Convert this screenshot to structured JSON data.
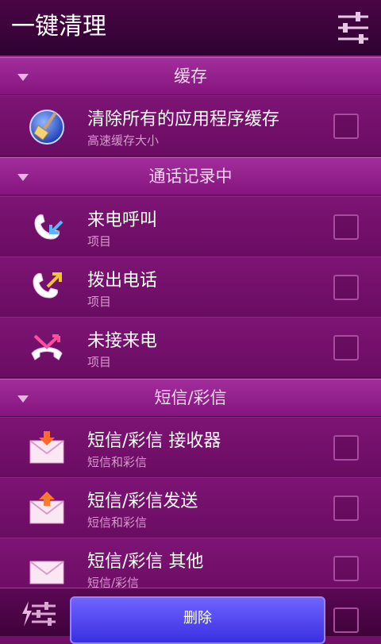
{
  "header": {
    "title": "一键清理",
    "settings_icon": "sliders-icon"
  },
  "sections": {
    "cache": {
      "label": "缓存"
    },
    "calls": {
      "label": "通话记录中"
    },
    "sms": {
      "label": "短信/彩信"
    }
  },
  "rows": {
    "cache_all": {
      "title": "清除所有的应用程序缓存",
      "subtitle": "高速缓存大小",
      "icon": "broom-icon"
    },
    "incoming": {
      "title": "来电呼叫",
      "subtitle": "项目",
      "icon": "incoming-call-icon"
    },
    "outgoing": {
      "title": "拨出电话",
      "subtitle": "项目",
      "icon": "outgoing-call-icon"
    },
    "missed": {
      "title": "未接来电",
      "subtitle": "项目",
      "icon": "missed-call-icon"
    },
    "sms_inbox": {
      "title": "短信/彩信 接收器",
      "subtitle": "短信和彩信",
      "icon": "mail-incoming-icon"
    },
    "sms_sent": {
      "title": "短信/彩信发送",
      "subtitle": "短信和彩信",
      "icon": "mail-outgoing-icon"
    },
    "sms_other": {
      "title": "短信/彩信 其他",
      "subtitle": "短信/彩信",
      "icon": "mail-icon"
    }
  },
  "bottom": {
    "delete_label": "删除",
    "tool_icon": "clean-settings-icon"
  },
  "colors": {
    "background": "#6f0f66",
    "header": "#3a0338",
    "button": "#4f45f0"
  }
}
